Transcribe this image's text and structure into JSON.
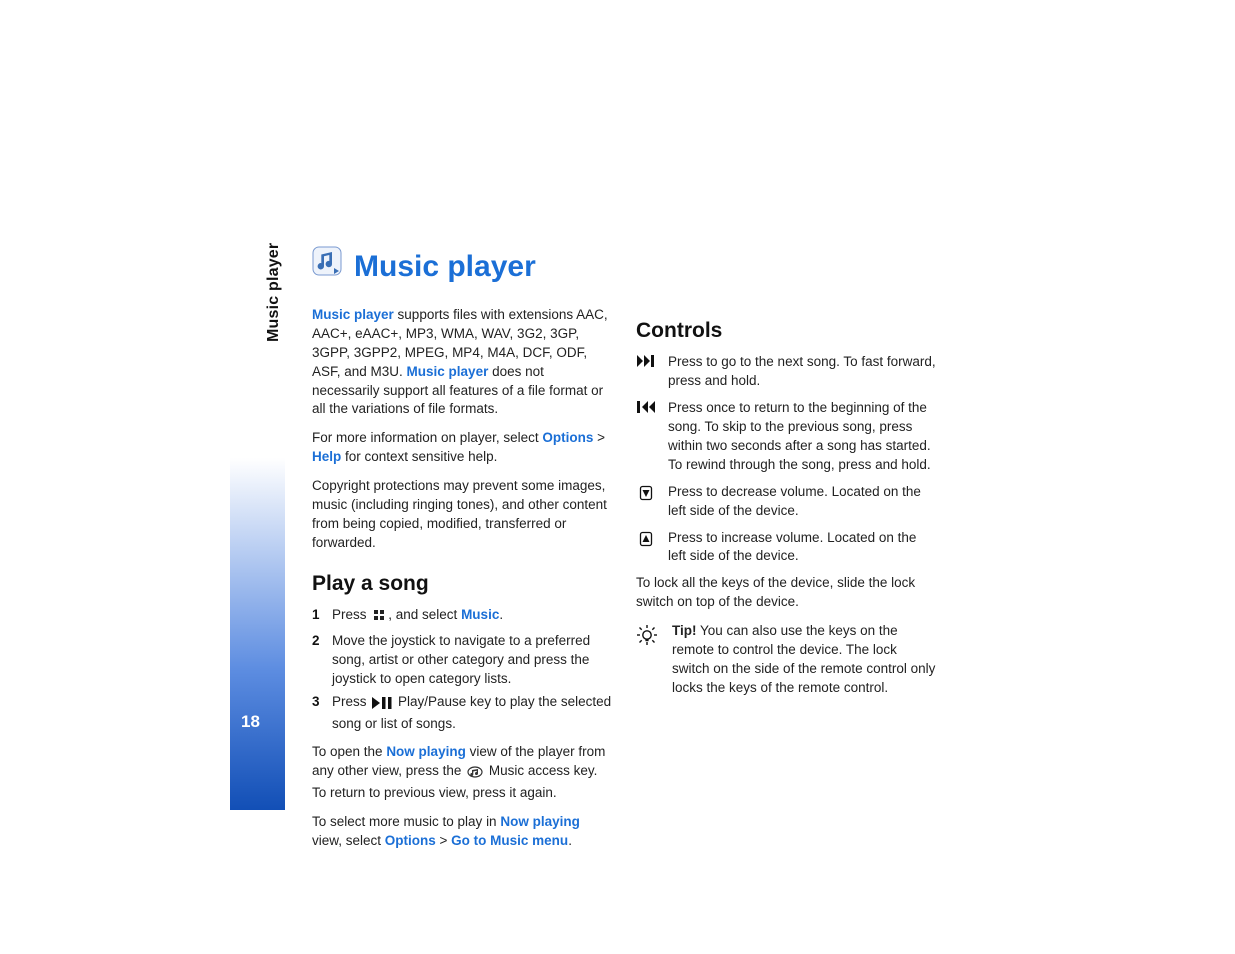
{
  "side_label": "Music player",
  "page_number": "18",
  "title": "Music player",
  "left": {
    "intro": {
      "lead1": "Music player",
      "p1_a": " supports files with extensions AAC, AAC+, eAAC+, MP3, WMA, WAV, 3G2, 3GP, 3GPP, 3GPP2, MPEG, MP4, M4A, DCF, ODF, ASF, and M3U. ",
      "lead2": "Music player",
      "p1_b": " does not necessarily support all features of a file format or all the variations of file formats.",
      "p2_a": "For more information on player, select ",
      "p2_opt": "Options",
      "p2_gt": " > ",
      "p2_help": "Help",
      "p2_b": " for context sensitive help.",
      "p3": "Copyright protections may prevent some images, music (including ringing tones), and other content from being copied, modified, transferred or forwarded."
    },
    "play_heading": "Play a song",
    "steps": [
      {
        "n": "1",
        "pre": "Press  ",
        "post": ", and select ",
        "blue": "Music",
        "end": "."
      },
      {
        "n": "2",
        "text": "Move the joystick to navigate to a preferred song, artist or other category and press the joystick to open category lists."
      },
      {
        "n": "3",
        "pre": "Press ",
        "post": " Play/Pause key to play the selected song or list of songs."
      }
    ],
    "nowplaying": {
      "a": "To open the ",
      "np": "Now playing",
      "b": " view of the player from any other view, press the  ",
      "c": "  Music access key. To return to previous view, press it again."
    },
    "select_more": {
      "a": "To select more music to play in ",
      "np": "Now playing",
      "b": " view, select ",
      "opt": "Options",
      "gt": " > ",
      "menu": "Go to Music menu",
      "end": "."
    }
  },
  "right": {
    "heading": "Controls",
    "items": [
      {
        "icon": "next",
        "text": "Press to go to the next song. To fast forward, press and hold."
      },
      {
        "icon": "prev",
        "text": "Press once to return to the beginning of the song. To skip to the previous song, press within two seconds after a song has started. To rewind through the song, press and hold."
      },
      {
        "icon": "voldown",
        "text": "Press to decrease volume. Located on the left side of the device."
      },
      {
        "icon": "volup",
        "text": "Press to increase volume. Located on the left side of the device."
      }
    ],
    "lock": "To lock all the keys of the device, slide the lock switch on top of the device.",
    "tip": {
      "label": "Tip!",
      "text": " You can also use the keys on the remote to control the device. The lock switch on the side of the remote control only locks the keys of the remote control."
    }
  }
}
